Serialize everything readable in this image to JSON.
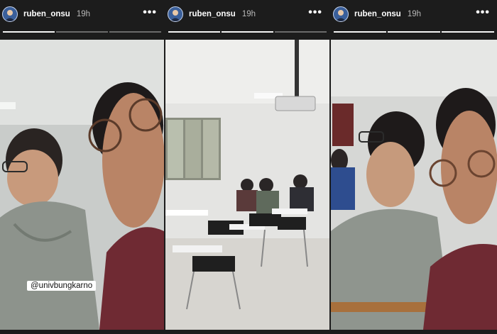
{
  "stories": [
    {
      "username": "ruben_onsu",
      "time": "19h",
      "more_icon": "more-horizontal-icon",
      "mention": "@univbungkarno",
      "progress": {
        "segments": 3,
        "active": 1
      }
    },
    {
      "username": "ruben_onsu",
      "time": "19h",
      "more_icon": "more-horizontal-icon",
      "progress": {
        "segments": 3,
        "active": 2
      }
    },
    {
      "username": "ruben_onsu",
      "time": "19h",
      "more_icon": "more-horizontal-icon",
      "progress": {
        "segments": 3,
        "active": 3
      }
    }
  ],
  "colors": {
    "background": "#1c1c1c",
    "progress_done": "#ffffff",
    "progress_pending": "#5a5a5a",
    "avatar_bg": "#3a5f9a"
  }
}
